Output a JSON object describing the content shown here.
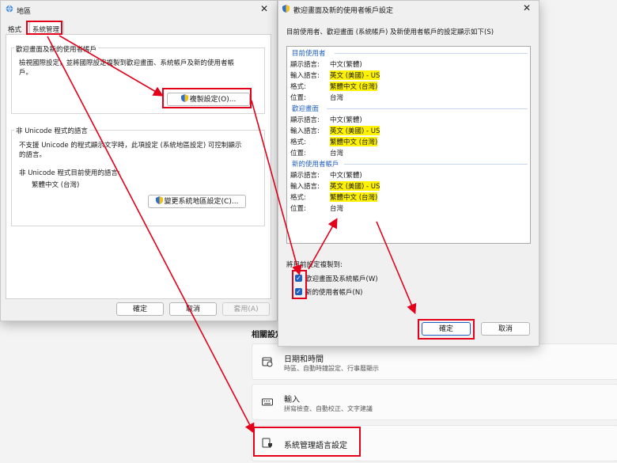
{
  "settings": {
    "related_heading": "相關設定",
    "cards": [
      {
        "title": "日期和時間",
        "subtitle": "時區、自動時鐘設定、行事曆顯示",
        "icon": "calendar-clock-icon"
      },
      {
        "title": "輸入",
        "subtitle": "拼寫檢查、自動校正、文字建議",
        "icon": "keyboard-icon"
      },
      {
        "title": "系統管理語言設定",
        "subtitle": "",
        "icon": "admin-language-icon"
      }
    ]
  },
  "region_dialog": {
    "title": "地區",
    "tabs": [
      "格式",
      "系統管理"
    ],
    "welcome_group": {
      "heading": "歡迎畫面及新的使用者帳戶",
      "desc_line1": "檢視國際設定，並將國際設定複製到歡迎畫面、系統帳戶及新的使用者帳",
      "desc_line2": "戶。",
      "copy_button": "複製設定(O)..."
    },
    "unicode_group": {
      "heading": "非 Unicode 程式的語言",
      "desc_line1": "不支援 Unicode 的程式顯示文字時，此項設定 (系統地區設定) 可控制顯示",
      "desc_line2": "的語言。",
      "current_label": "非 Unicode 程式目前使用的語言:",
      "current_value": "繁體中文 (台灣)",
      "change_button": "變更系統地區設定(C)..."
    },
    "buttons": {
      "ok": "確定",
      "cancel": "取消",
      "apply": "套用(A)"
    }
  },
  "copy_dialog": {
    "title": "歡迎畫面及新的使用者帳戶設定",
    "intro": "目前使用者、歡迎畫面 (系統帳戶) 及新使用者帳戶的設定顯示如下(S)",
    "sections": [
      {
        "name": "目前使用者",
        "display": "中文(繁體)",
        "input": "英文 (美國) - US",
        "format": "繁體中文 (台灣)",
        "location": "台灣"
      },
      {
        "name": "歡迎畫面",
        "display": "中文(繁體)",
        "input": "英文 (美國) - US",
        "format": "繁體中文 (台灣)",
        "location": "台灣"
      },
      {
        "name": "新的使用者帳戶",
        "display": "中文(繁體)",
        "input": "英文 (美國) - US",
        "format": "繁體中文 (台灣)",
        "location": "台灣"
      }
    ],
    "labels": {
      "display": "顯示語言:",
      "input": "輸入語言:",
      "format": "格式:",
      "location": "位置:"
    },
    "copy_to_label": "將目前設定複製到:",
    "checkboxes": [
      {
        "label": "歡迎畫面及系統帳戶(W)",
        "checked": true
      },
      {
        "label": "新的使用者帳戶(N)",
        "checked": true
      }
    ],
    "buttons": {
      "ok": "確定",
      "cancel": "取消"
    }
  },
  "colors": {
    "highlight": "#fff200",
    "annotation": "#e2001a",
    "accent": "#1f5fbf"
  }
}
